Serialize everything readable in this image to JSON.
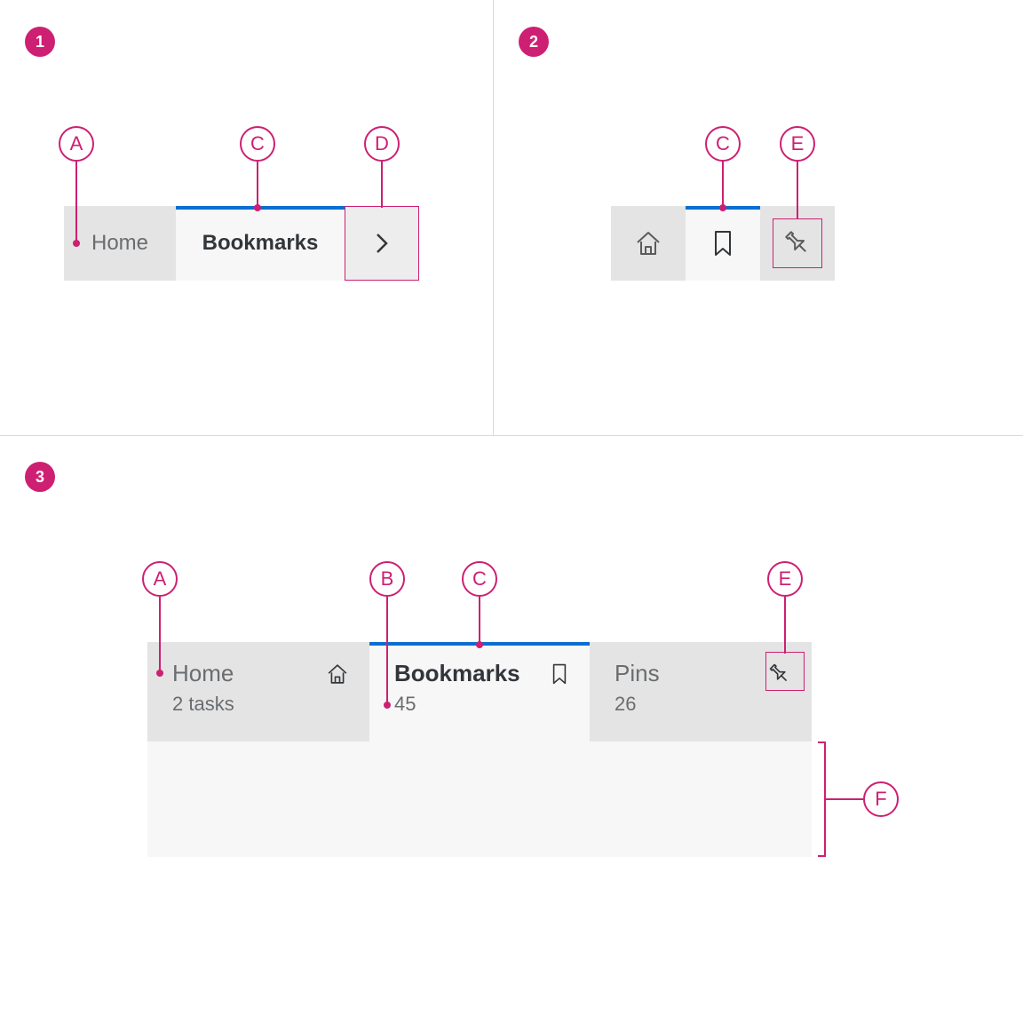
{
  "sections": {
    "one": "1",
    "two": "2",
    "three": "3"
  },
  "callouts": {
    "A": "A",
    "B": "B",
    "C": "C",
    "D": "D",
    "E": "E",
    "F": "F"
  },
  "example1": {
    "tab_home": "Home",
    "tab_bookmarks": "Bookmarks"
  },
  "example3": {
    "home": {
      "title": "Home",
      "sub": "2 tasks"
    },
    "bookmarks": {
      "title": "Bookmarks",
      "sub": "45"
    },
    "pins": {
      "title": "Pins",
      "sub": "26"
    }
  },
  "colors": {
    "accent": "#cd2072",
    "selection": "#0a6ed1",
    "tab_bg": "#e4e4e4",
    "tab_selected_bg": "#f7f7f7",
    "text_muted": "#6a6d70"
  }
}
